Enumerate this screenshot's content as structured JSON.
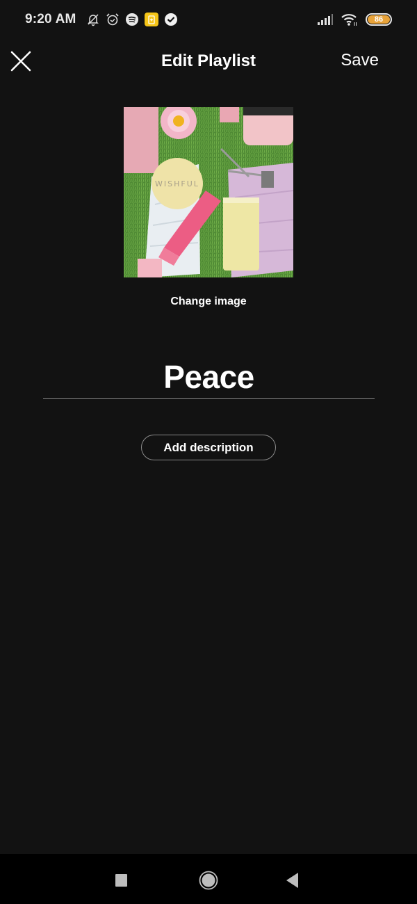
{
  "status_bar": {
    "time": "9:20 AM",
    "left_icons": [
      "bell-off-icon",
      "alarm-icon",
      "spotify-icon",
      "notes-app-icon",
      "check-circle-icon"
    ],
    "right_icons": [
      "signal-icon",
      "wifi-icon"
    ],
    "battery_level": "86",
    "battery_color": "#e8a33a"
  },
  "header": {
    "title": "Edit Playlist",
    "close_icon": "close-icon",
    "save_label": "Save"
  },
  "cover": {
    "alt": "Playlist cover image",
    "change_image_label": "Change image"
  },
  "playlist": {
    "name": "Peace",
    "add_description_label": "Add description"
  },
  "nav_bar": {
    "recents_icon": "square-icon",
    "home_icon": "circle-icon",
    "back_icon": "triangle-back-icon"
  },
  "colors": {
    "background": "#121212",
    "text": "#ffffff",
    "divider": "#8a8a8a"
  }
}
